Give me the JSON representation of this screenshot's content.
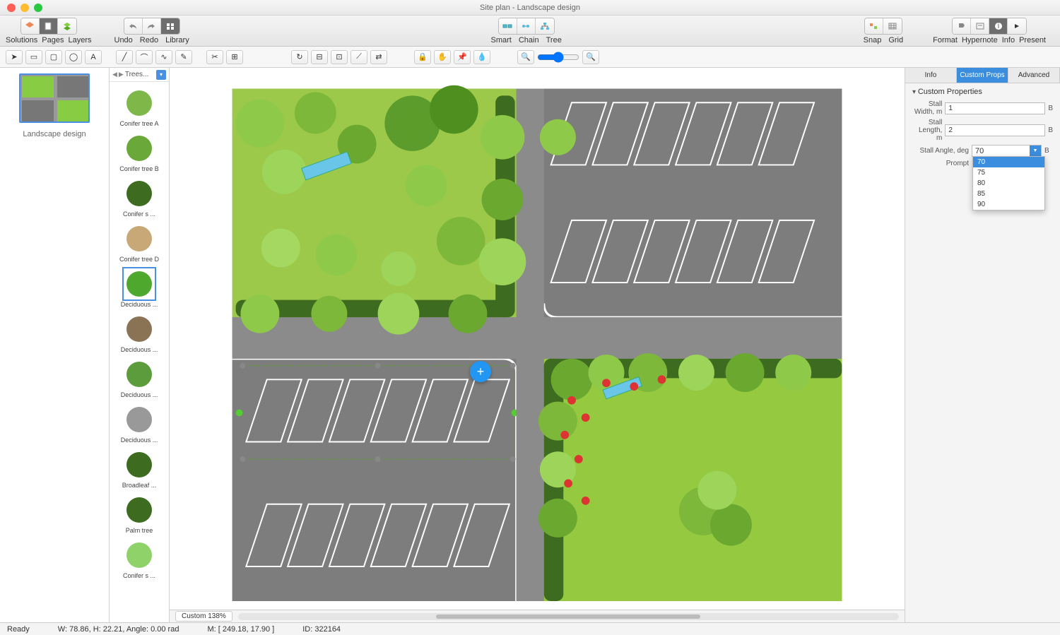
{
  "window": {
    "title": "Site plan - Landscape design"
  },
  "toolbar": {
    "solutions": "Solutions",
    "pages": "Pages",
    "layers": "Layers",
    "undo": "Undo",
    "redo": "Redo",
    "library": "Library",
    "smart": "Smart",
    "chain": "Chain",
    "tree": "Tree",
    "snap": "Snap",
    "grid": "Grid",
    "format": "Format",
    "hypernote": "Hypernote",
    "info": "Info",
    "present": "Present"
  },
  "thumb": {
    "label": "Landscape design"
  },
  "library": {
    "title": "Trees...",
    "items": [
      {
        "label": "Conifer tree  A"
      },
      {
        "label": "Conifer tree B"
      },
      {
        "label": "Conifer s ..."
      },
      {
        "label": "Conifer tree D"
      },
      {
        "label": "Deciduous ...",
        "selected": true
      },
      {
        "label": "Deciduous ..."
      },
      {
        "label": "Deciduous ..."
      },
      {
        "label": "Deciduous ..."
      },
      {
        "label": "Broadleaf ..."
      },
      {
        "label": "Palm tree"
      },
      {
        "label": "Conifer s ..."
      }
    ]
  },
  "inspector": {
    "tabs": {
      "info": "Info",
      "custom": "Custom Props",
      "advanced": "Advanced"
    },
    "section": "Custom Properties",
    "props": {
      "stall_width_lbl": "Stall Width, m",
      "stall_width_val": "1",
      "stall_length_lbl": "Stall Length, m",
      "stall_length_val": "2",
      "stall_angle_lbl": "Stall Angle, deg",
      "stall_angle_val": "70",
      "prompt_lbl": "Prompt",
      "b": "B"
    },
    "angle_options": [
      "70",
      "75",
      "80",
      "85",
      "90"
    ],
    "angle_selected": "70"
  },
  "canvas": {
    "zoom": "Custom 138%"
  },
  "status": {
    "ready": "Ready",
    "wh": "W: 78.86,  H: 22.21,  Angle: 0.00 rad",
    "m": "M: [ 249.18, 17.90 ]",
    "id": "ID: 322164"
  }
}
